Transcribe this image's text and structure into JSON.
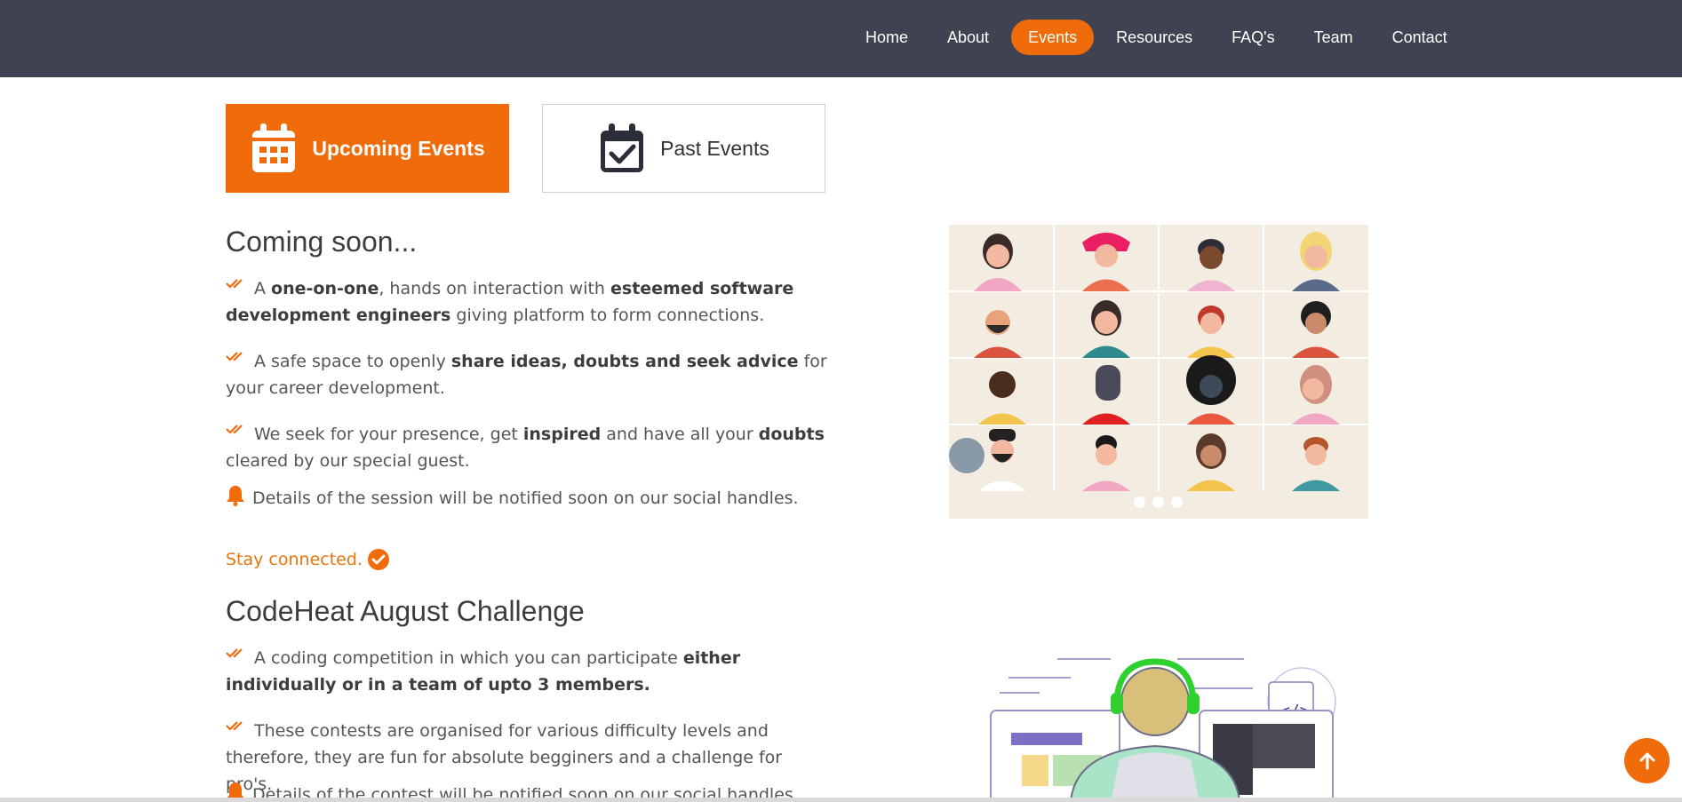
{
  "nav": {
    "items": [
      "Home",
      "About",
      "Events",
      "Resources",
      "FAQ's",
      "Team",
      "Contact"
    ],
    "active": "Events"
  },
  "tabs": {
    "upcoming": "Upcoming Events",
    "past": "Past Events"
  },
  "coming_soon": {
    "title": "Coming soon...",
    "p1": {
      "a": "A ",
      "b1": "one-on-one",
      "c": ", hands on interaction with ",
      "b2": "esteemed software development engineers",
      "d": " giving platform to form connections."
    },
    "p2": {
      "a": "A safe space to openly ",
      "b1": "share ideas, doubts and seek advice",
      "c": " for your career development."
    },
    "p3": {
      "a": "We seek for your presence, get ",
      "b1": "inspired",
      "c": " and have all your ",
      "b2": "doubts",
      "d": " cleared by our special guest."
    },
    "p4": "Details of the session will be notified soon on our social handles.",
    "stay": "Stay connected."
  },
  "codeheat": {
    "title": "CodeHeat August Challenge",
    "p1": {
      "a": "A coding competition in which you can participate ",
      "b1": "either individually or in a team of upto 3 members."
    },
    "p2": "These contests are organised for various difficulty levels and therefore, they are fun for absolute begginers and a challenge for pro's.",
    "p3": "Details of the contest will be notified soon on our social handles."
  },
  "colors": {
    "accent": "#f06c0b",
    "navbar": "#3f4351"
  },
  "icons": {
    "upcoming": "calendar-icon",
    "past": "calendar-check-icon",
    "bullet": "double-check-icon",
    "bell": "bell-icon",
    "stay": "check-circle-icon",
    "to_top": "arrow-up-icon"
  }
}
